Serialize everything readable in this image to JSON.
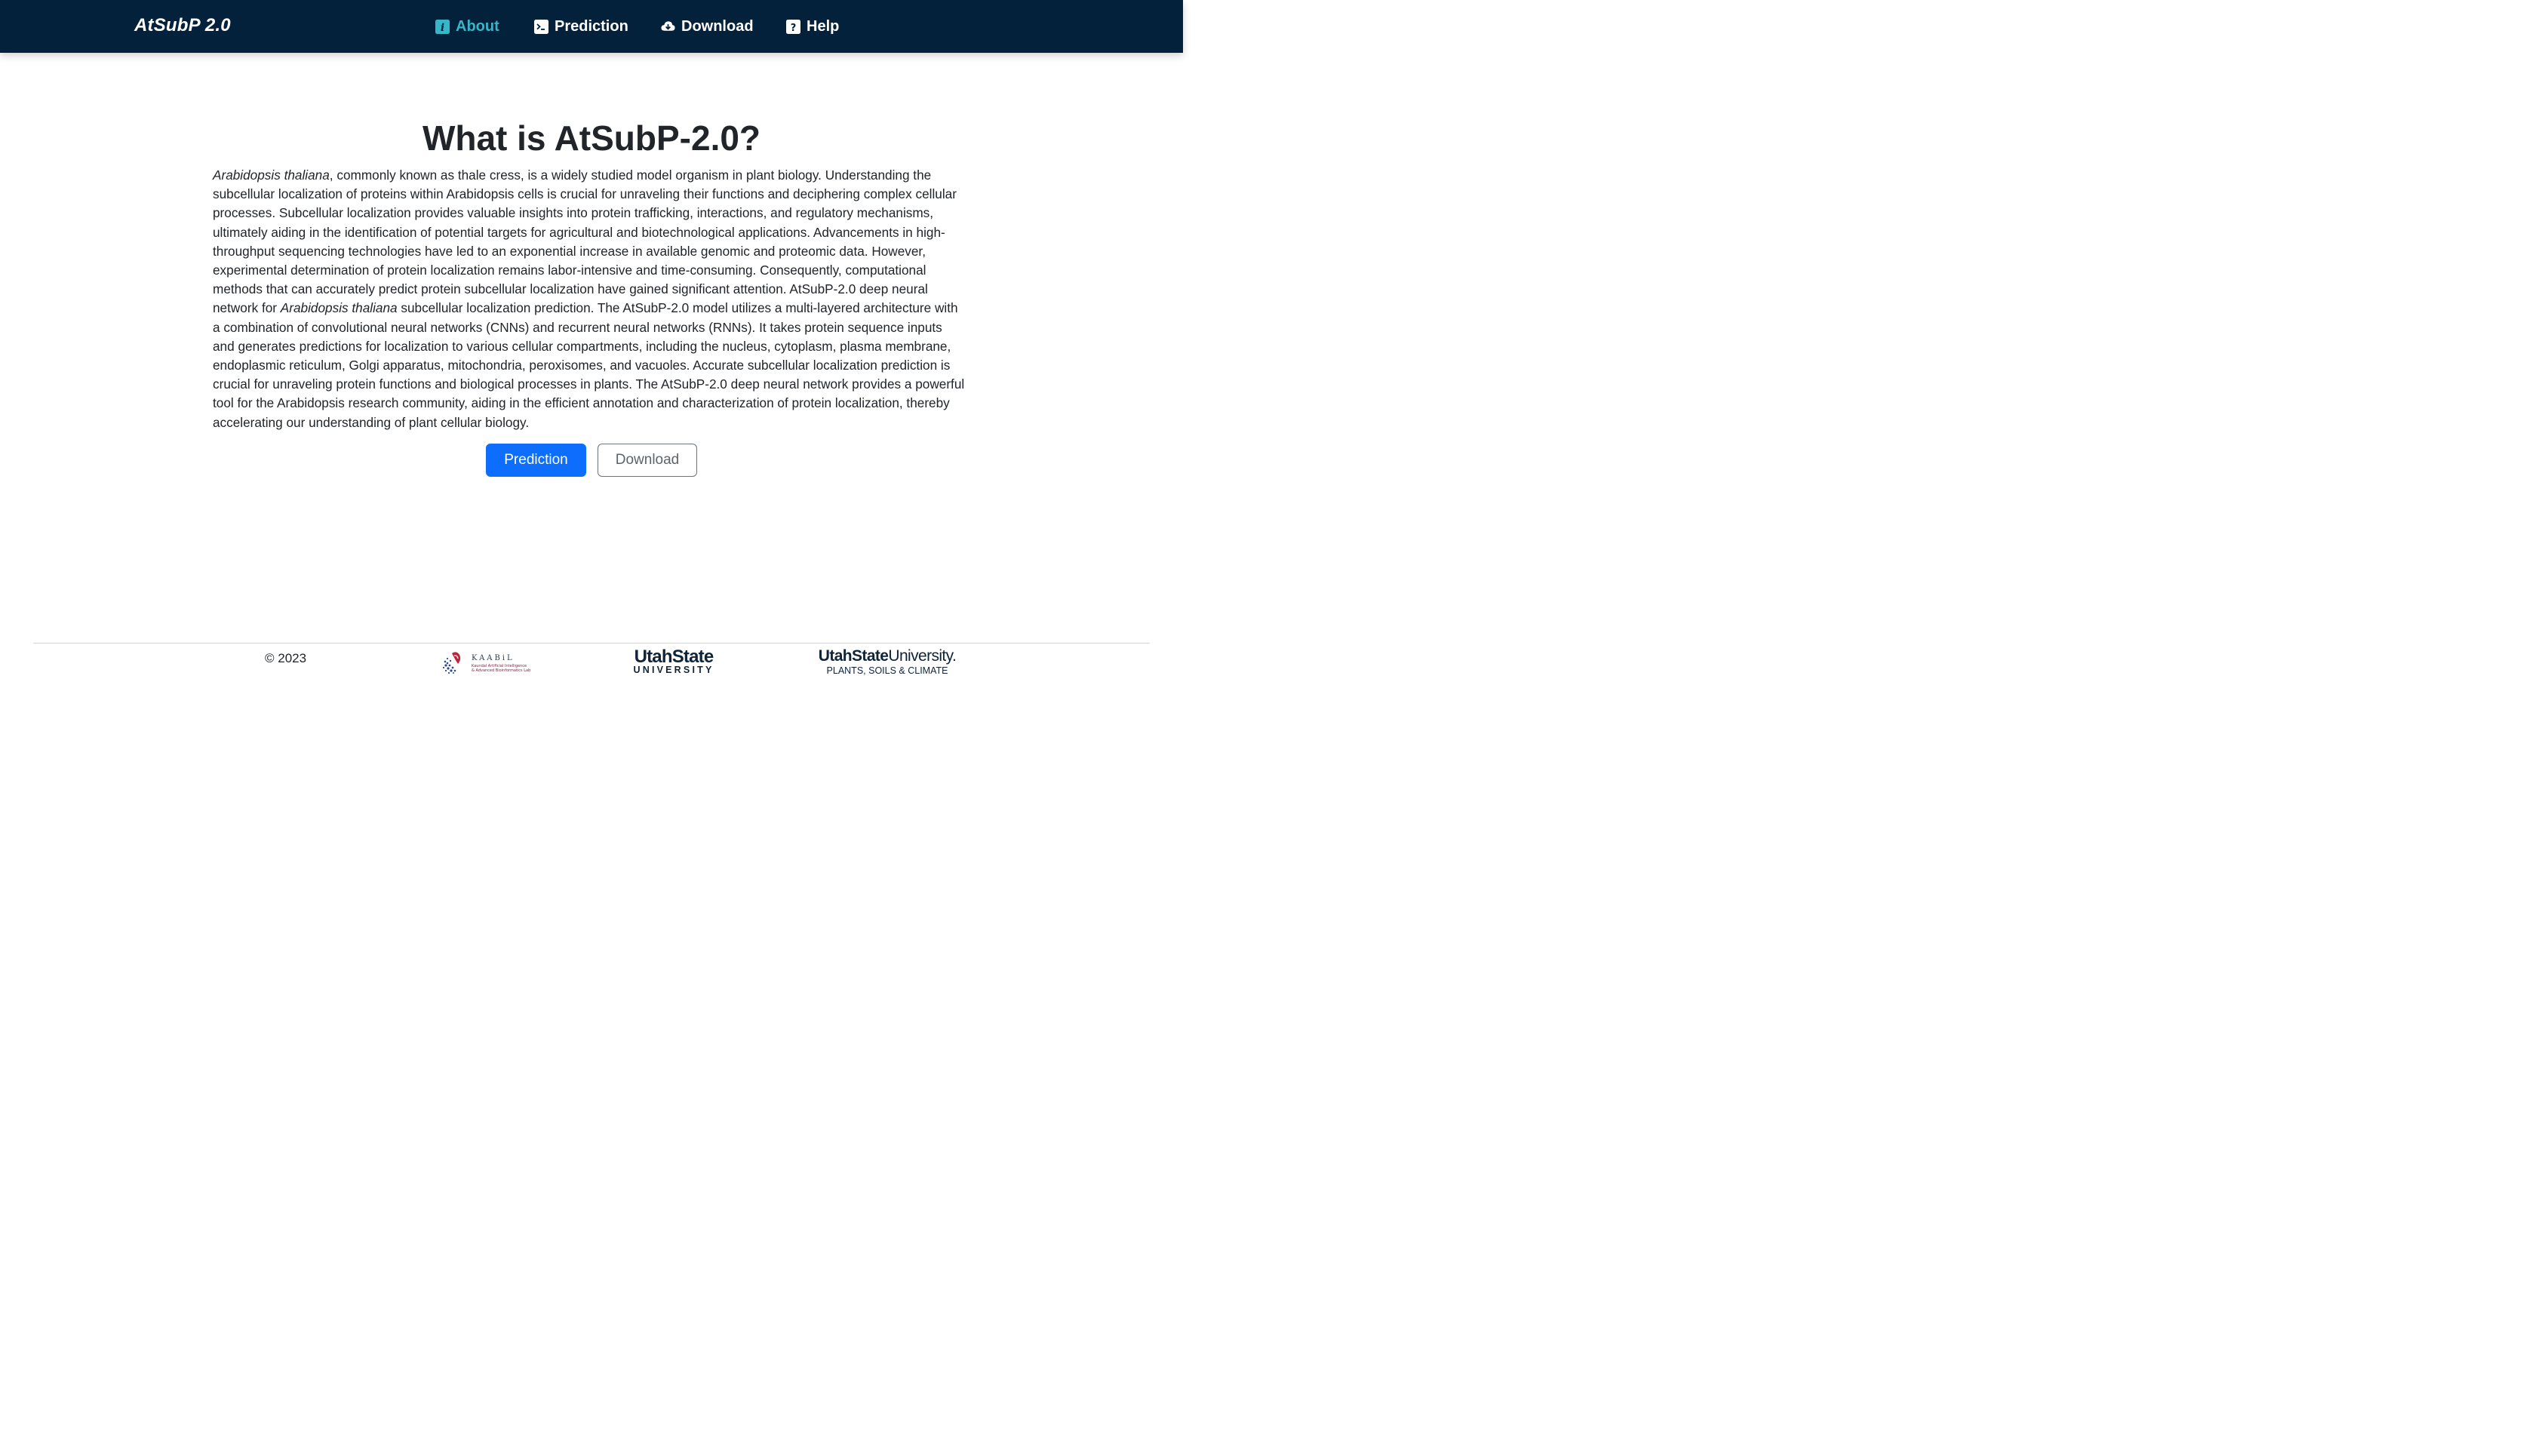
{
  "nav": {
    "brand": "AtSubP 2.0",
    "items": [
      {
        "label": "About",
        "icon": "info-icon",
        "active": true
      },
      {
        "label": "Prediction",
        "icon": "terminal-icon"
      },
      {
        "label": "Download",
        "icon": "cloud-download-icon"
      },
      {
        "label": "Help",
        "icon": "question-icon"
      }
    ]
  },
  "main": {
    "title": "What is AtSubP-2.0?",
    "paragraph": {
      "p1_italic": "Arabidopsis thaliana",
      "p1": ", commonly known as thale cress, is a widely studied model organism in plant biology. Understanding the subcellular localization of proteins within Arabidopsis cells is crucial for unraveling their functions and deciphering complex cellular processes. Subcellular localization provides valuable insights into protein trafficking, interactions, and regulatory mechanisms, ultimately aiding in the identification of potential targets for agricultural and biotechnological applications. Advancements in high-throughput sequencing technologies have led to an exponential increase in available genomic and proteomic data. However, experimental determination of protein localization remains labor-intensive and time-consuming. Consequently, computational methods that can accurately predict protein subcellular localization have gained significant attention. ",
      "p2_name": "AtSubP-2.0",
      "p2": " deep neural network for ",
      "p2_italic": "Arabidopsis thaliana",
      "p3": " subcellular localization prediction. The ",
      "p3_name": "AtSubP-2.0",
      "p4": " model utilizes a multi-layered architecture with a combination of convolutional neural networks (CNNs) and recurrent neural networks (RNNs). It takes protein sequence inputs and generates predictions for localization to various cellular compartments, including the nucleus, cytoplasm, plasma membrane, endoplasmic reticulum, Golgi apparatus, mitochondria, peroxisomes, and vacuoles. Accurate subcellular localization prediction is crucial for unraveling protein functions and biological processes in plants. The ",
      "p4_name": "AtSubP-2.0",
      "p5": " deep neural network provides a powerful tool for the Arabidopsis research community, aiding in the efficient annotation and characterization of protein localization, thereby accelerating our understanding of plant cellular biology."
    },
    "buttons": {
      "prediction": "Prediction",
      "download": "Download"
    }
  },
  "footer": {
    "copyright": "© 2023",
    "kaabil_name": "KAABiL",
    "kaabil_sub1": "Kaundal Artificial Intelligence",
    "kaabil_sub2": "& Advanced Bioinformatics Lab",
    "usu_top": "UtahState",
    "usu_bottom": "UNIVERSITY",
    "psc_bold": "UtahState",
    "psc_regular": "University.",
    "psc_sub": "PLANTS, SOILS & CLIMATE"
  },
  "colors": {
    "navbar": "#03213a",
    "active_nav": "#36b6c7",
    "primary_button": "#0d6efd"
  }
}
